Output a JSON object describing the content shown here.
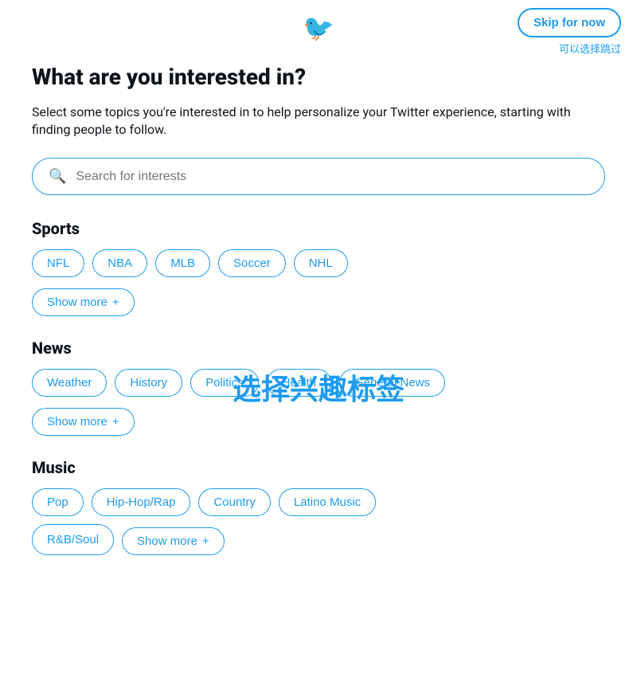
{
  "header": {
    "logo_symbol": "🐦",
    "skip_button_label": "Skip for now",
    "skip_subtitle": "可以选择跳过"
  },
  "main": {
    "title": "What are you interested in?",
    "description": "Select some topics you're interested in to help personalize your Twitter experience, starting with finding people to follow.",
    "search_placeholder": "Search for interests",
    "overlay_text": "选择兴趣标签",
    "sections": [
      {
        "id": "sports",
        "title": "Sports",
        "tags": [
          "NFL",
          "NBA",
          "MLB",
          "Soccer",
          "NHL"
        ],
        "show_more_label": "Show more"
      },
      {
        "id": "news",
        "title": "News",
        "tags": [
          "Weather",
          "History",
          "Politics",
          "Health",
          "General News"
        ],
        "show_more_label": "Show more"
      },
      {
        "id": "music",
        "title": "Music",
        "tags": [
          "Pop",
          "Hip-Hop/Rap",
          "Country",
          "Latino Music"
        ],
        "extra_tags": [
          "R&B/Soul"
        ],
        "show_more_label": "Show more"
      }
    ]
  }
}
